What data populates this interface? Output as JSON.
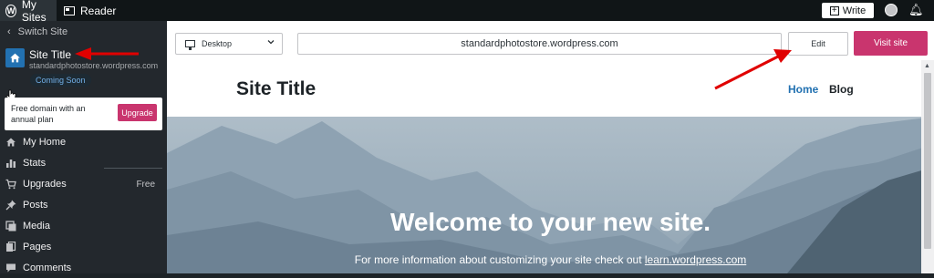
{
  "topbar": {
    "my_sites": "My Sites",
    "reader": "Reader",
    "write": "Write",
    "icons": [
      "wordpress-icon",
      "reader-icon",
      "write-icon",
      "avatar",
      "notifications-icon"
    ]
  },
  "sidebar": {
    "switch_site": "Switch Site",
    "site": {
      "title": "Site Title",
      "url": "standardphotostore.wordpress.com",
      "status": "Coming Soon"
    },
    "upsell": {
      "text": "Free domain with an annual plan",
      "button": "Upgrade"
    },
    "items": [
      {
        "label": "My Home",
        "icon": "home-icon",
        "badge": ""
      },
      {
        "label": "Stats",
        "icon": "stats-icon",
        "badge": ""
      },
      {
        "label": "Upgrades",
        "icon": "cart-icon",
        "badge": "Free"
      },
      {
        "label": "Posts",
        "icon": "pin-icon",
        "badge": ""
      },
      {
        "label": "Media",
        "icon": "media-icon",
        "badge": ""
      },
      {
        "label": "Pages",
        "icon": "pages-icon",
        "badge": ""
      },
      {
        "label": "Comments",
        "icon": "comments-icon",
        "badge": ""
      }
    ]
  },
  "toolbar": {
    "device": "Desktop",
    "url": "standardphotostore.wordpress.com",
    "edit": "Edit",
    "visit": "Visit site"
  },
  "preview": {
    "site_title": "Site Title",
    "nav": [
      "Home",
      "Blog"
    ],
    "hero_title": "Welcome to your new site.",
    "hero_sub_prefix": "For more information about customizing your site check out ",
    "hero_sub_link": "learn.wordpress.com"
  },
  "colors": {
    "accent": "#c9356e",
    "link": "#2271b1",
    "annotation": "#e00000"
  }
}
